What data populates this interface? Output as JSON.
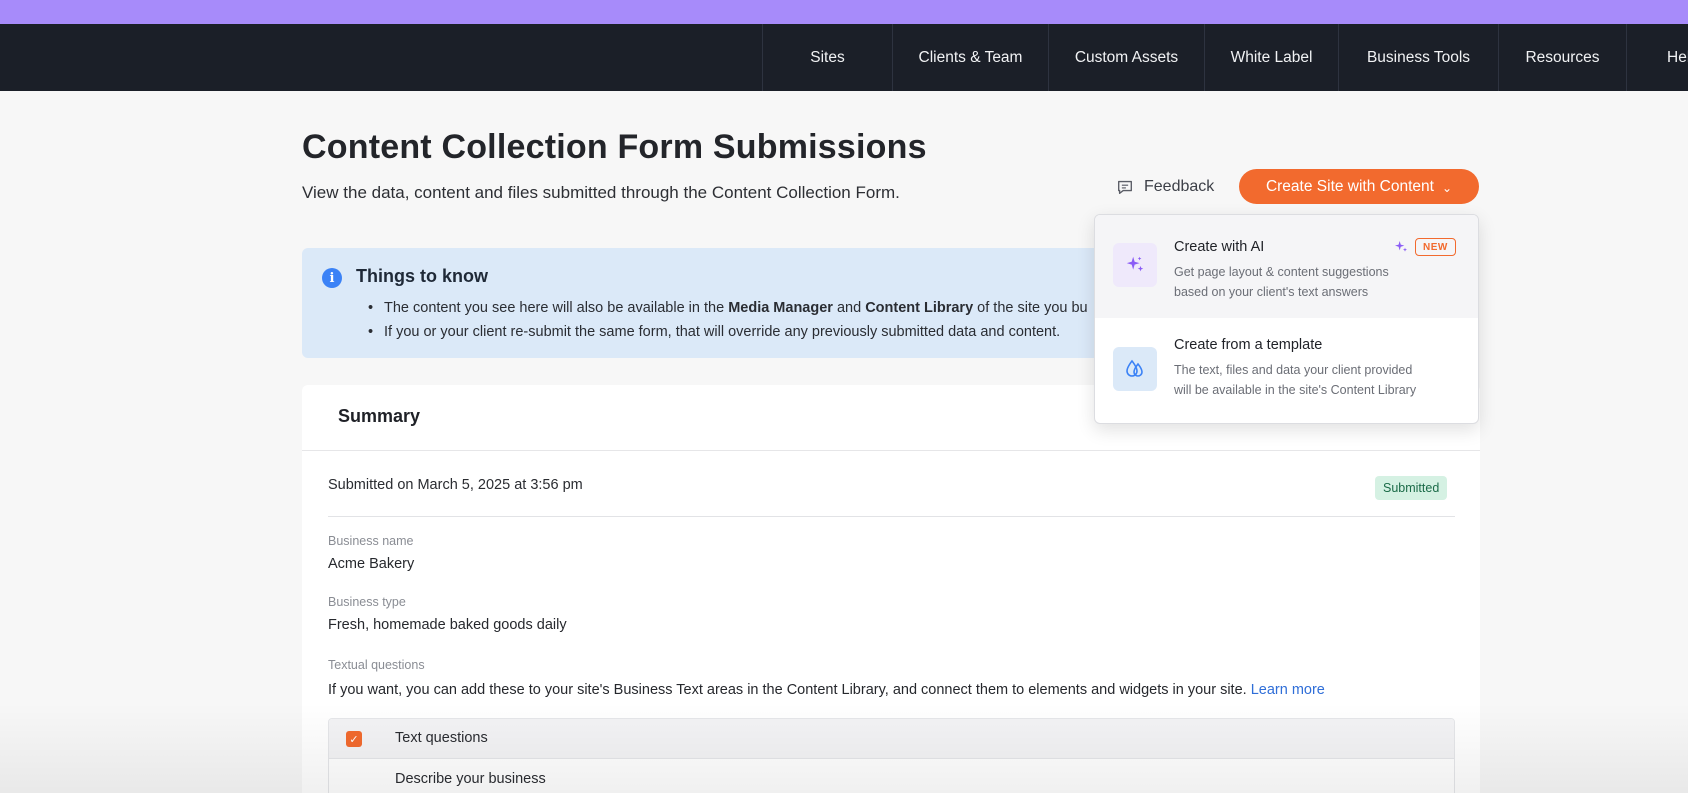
{
  "nav": {
    "items": [
      {
        "label": "Sites"
      },
      {
        "label": "Clients & Team"
      },
      {
        "label": "Custom Assets"
      },
      {
        "label": "White Label"
      },
      {
        "label": "Business Tools"
      },
      {
        "label": "Resources"
      },
      {
        "label": "Hel"
      }
    ]
  },
  "page": {
    "title": "Content Collection Form Submissions",
    "subtitle": "View the data, content and files submitted through the Content Collection Form."
  },
  "actions": {
    "feedback_label": "Feedback",
    "create_label": "Create Site with Content",
    "create_icon": "chevron-down-icon"
  },
  "info": {
    "title": "Things to know",
    "bullet1_a": "The content you see here will also be available in the ",
    "bullet1_b": "Media Manager",
    "bullet1_c": " and ",
    "bullet1_d": "Content Library",
    "bullet1_e": " of the site you bu",
    "bullet2": "If you or your client re-submit the same form, that will override any previously submitted data and content."
  },
  "dropdown": {
    "items": [
      {
        "title": "Create with AI",
        "badge": "NEW",
        "desc_line1": "Get page layout & content suggestions",
        "desc_line2": "based on your client's text answers",
        "icon": "sparkles-icon"
      },
      {
        "title": "Create from a template",
        "desc_line1": "The text, files and data your client provided",
        "desc_line2": "will be available in the site's Content Library",
        "icon": "droplets-icon"
      }
    ]
  },
  "summary": {
    "title": "Summary",
    "submitted_on": "Submitted on March 5, 2025 at 3:56 pm",
    "status": "Submitted",
    "fields": {
      "business_name_label": "Business name",
      "business_name_value": "Acme Bakery",
      "business_type_label": "Business type",
      "business_type_value": "Fresh, homemade baked goods daily",
      "textual_label": "Textual questions",
      "textual_help": "If you want, you can add these to your site's Business Text areas in the Content Library, and connect them to elements and widgets in your site. ",
      "learn_more": "Learn more"
    },
    "table": {
      "header_label": "Text questions",
      "checked": true,
      "rows": [
        "Describe your business"
      ]
    }
  },
  "colors": {
    "accent": "#f26a2e",
    "nav_bg": "#1b1f28",
    "top_strip": "#a78bfa",
    "info_bg": "#dbe9f8",
    "status_bg": "#d5f1e3"
  }
}
